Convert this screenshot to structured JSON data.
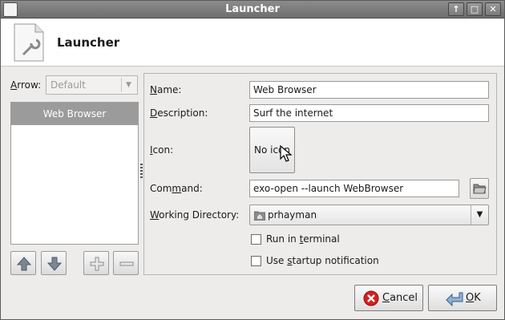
{
  "window": {
    "title": "Launcher"
  },
  "header": {
    "title": "Launcher"
  },
  "arrow": {
    "label_prefix": "A",
    "label_rest": "rrow:",
    "selected": "Default"
  },
  "items": [
    {
      "label": "Web Browser"
    }
  ],
  "fields": {
    "name": {
      "label_prefix": "N",
      "label_rest": "ame:",
      "value": "Web Browser"
    },
    "description": {
      "label_prefix": "D",
      "label_rest": "escription:",
      "value": "Surf the internet"
    },
    "icon": {
      "label_prefix": "I",
      "label_rest": "con:",
      "button_text": "No icon"
    },
    "command": {
      "label_a": "Com",
      "label_u": "m",
      "label_b": "and:",
      "value": "exo-open --launch WebBrowser"
    },
    "working_dir": {
      "label_prefix": "W",
      "label_rest": "orking Directory:",
      "value": "prhayman"
    }
  },
  "options": {
    "run_in_terminal": {
      "label_a": "Run in ",
      "label_u": "t",
      "label_b": "erminal",
      "checked": false
    },
    "startup_notification": {
      "label_a": "Use ",
      "label_u": "s",
      "label_b": "tartup notification",
      "checked": false
    }
  },
  "buttons": {
    "cancel": {
      "label_u": "C",
      "label_rest": "ancel"
    },
    "ok": {
      "label_u": "O",
      "label_rest": "K"
    }
  },
  "colors": {
    "titlebar": "#7d7d7d",
    "selection": "#9b9b9b",
    "cancel_icon": "#d42020"
  }
}
